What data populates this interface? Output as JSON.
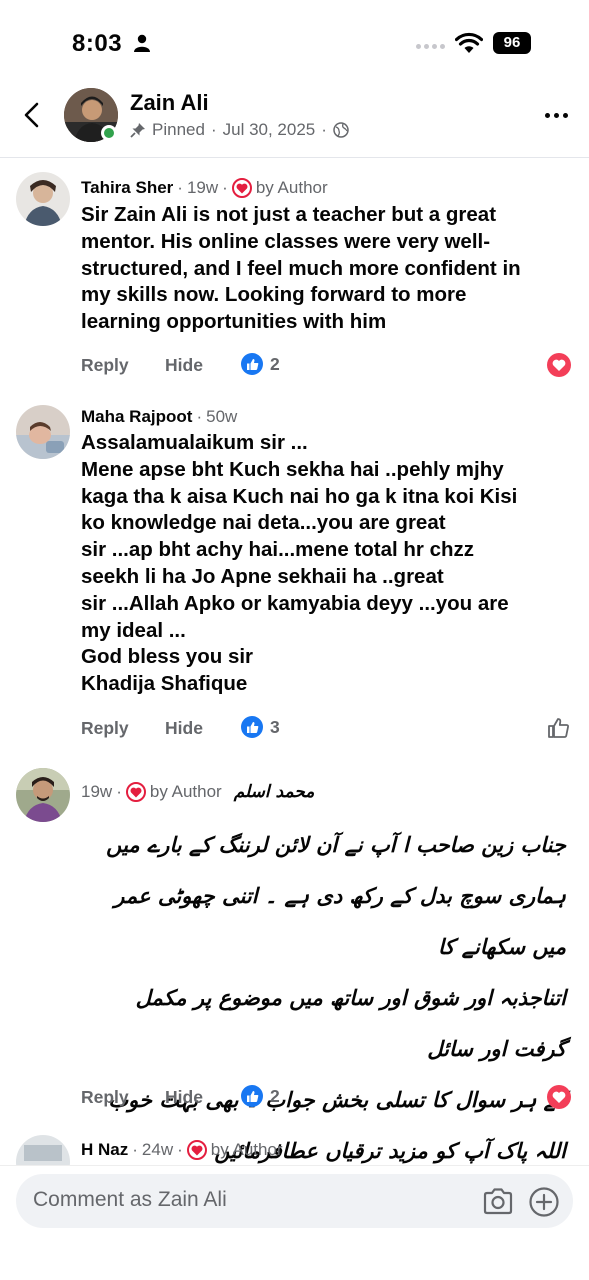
{
  "status": {
    "time": "8:03",
    "battery": "96"
  },
  "header": {
    "name": "Zain Ali",
    "pinned": "Pinned",
    "date": "Jul 30, 2025"
  },
  "comments": [
    {
      "author": "Tahira Sher",
      "age": "19w",
      "badge": "by Author",
      "text_lines": [
        "Sir Zain Ali is not just a teacher but a great",
        "mentor. His online classes were very well-",
        "structured, and I feel much more confident in",
        "my skills now. Looking forward to more",
        "learning opportunities with him"
      ],
      "reply": "Reply",
      "hide": "Hide",
      "likes": "2",
      "reaction": "love"
    },
    {
      "author": "Maha Rajpoot",
      "age": "50w",
      "text_lines": [
        "Assalamualaikum sir ...",
        "Mene apse bht Kuch sekha hai ..pehly mjhy",
        "kaga tha k aisa Kuch nai ho ga k itna koi Kisi",
        "ko knowledge nai deta...you are great",
        "sir ...ap bht achy hai...mene total hr chzz",
        "seekh li ha Jo Apne sekhaii ha ..great",
        "sir ...Allah Apko or kamyabia deyy ...you are",
        "my ideal ...",
        "God bless you sir",
        "Khadija Shafique"
      ],
      "reply": "Reply",
      "hide": "Hide",
      "likes": "3",
      "reaction": "like-outline"
    },
    {
      "author": "محمد اسلم",
      "age": "19w",
      "badge": "by Author",
      "text_lines": [
        "جناب زین صاحب ا آپ نے آن لائن لرننگ کے بارے میں",
        "ہماری سوچ بدل کے رکھ دی ہے ۔ اتنی چھوٹی عمر میں سکھانے کا",
        "اتناجذبہ اور شوق اور ساتھ میں موضوع پر مکمل گرفت اور سائل",
        "کے ہر سوال کا تسلی بخش جواب ۔ بھی بہت خوب",
        "اللہ پاک آپ کو مزید ترقیاں عطافرمائیں"
      ],
      "reply": "Reply",
      "hide": "Hide",
      "likes": "2",
      "reaction": "love"
    },
    {
      "author": "H Naz",
      "age": "24w",
      "badge": "by Author"
    }
  ],
  "composer": {
    "placeholder": "Comment as Zain Ali"
  }
}
